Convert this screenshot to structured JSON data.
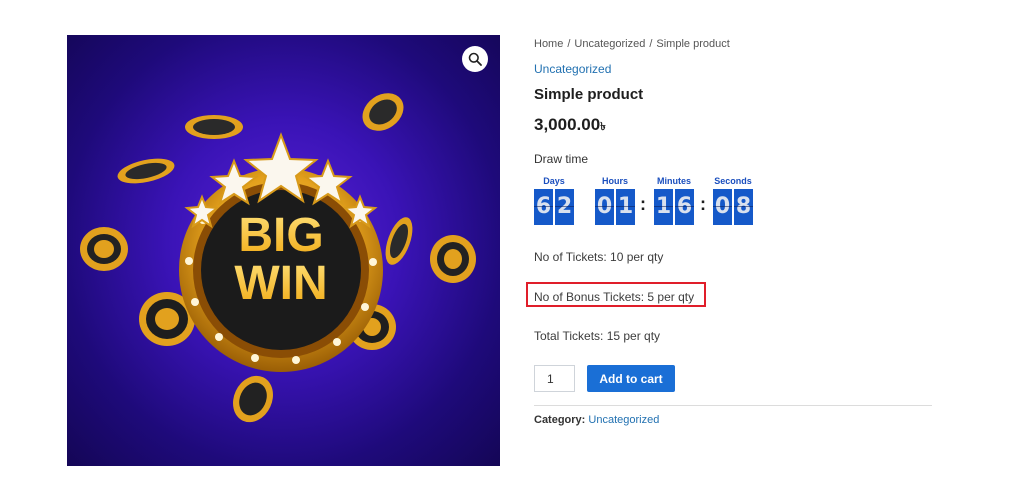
{
  "image": {
    "title_line1": "BIG",
    "title_line2": "WIN",
    "zoom_icon": "magnifier-icon",
    "colors": {
      "background": "#3a13b6",
      "gold": "#e9a520",
      "dark": "#1b1b1b"
    }
  },
  "breadcrumb": {
    "home": "Home",
    "category": "Uncategorized",
    "current": "Simple product",
    "separator": "/"
  },
  "product": {
    "category": "Uncategorized",
    "title": "Simple product",
    "price": "3,000.00",
    "currency": "৳"
  },
  "countdown": {
    "label": "Draw time",
    "days_label": "Days",
    "hours_label": "Hours",
    "minutes_label": "Minutes",
    "seconds_label": "Seconds",
    "days": [
      "6",
      "2"
    ],
    "hours": [
      "0",
      "1"
    ],
    "minutes": [
      "1",
      "6"
    ],
    "seconds": [
      "0",
      "8"
    ],
    "colon": ":"
  },
  "tickets": {
    "no_of_tickets": "No of Tickets: 10 per qty",
    "bonus_tickets": "No of Bonus Tickets: 5 per qty",
    "total_tickets": "Total Tickets: 15 per qty"
  },
  "cart": {
    "quantity": "1",
    "add_to_cart": "Add to cart"
  },
  "meta": {
    "category_label": "Category:",
    "category_value": "Uncategorized"
  },
  "highlight_color": "#e01e2a",
  "accent_color": "#1a6fd6"
}
